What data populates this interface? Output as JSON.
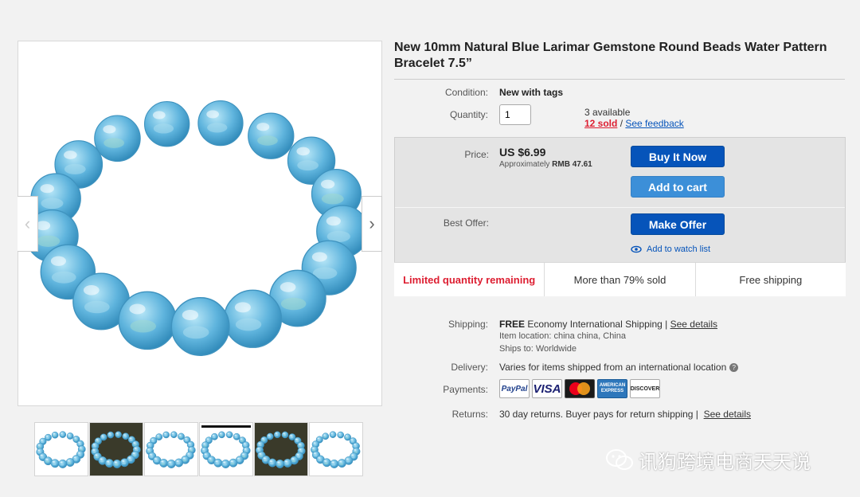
{
  "gallery": {
    "prev_icon": "chevron-left-icon",
    "next_icon": "chevron-right-icon",
    "prev_symbol": "‹",
    "next_symbol": "›",
    "thumbnails": [
      "thumb-1",
      "thumb-2",
      "thumb-3",
      "thumb-4",
      "thumb-5",
      "thumb-6"
    ]
  },
  "item": {
    "title": "New 10mm Natural Blue Larimar Gemstone Round Beads Water Pattern Bracelet 7.5”"
  },
  "details": {
    "condition_label": "Condition:",
    "condition_value": "New with tags",
    "quantity_label": "Quantity:",
    "quantity_value": "1",
    "available": "3 available",
    "sold": "12 sold",
    "sold_sep": " / ",
    "see_feedback": "See feedback"
  },
  "buybox": {
    "price_label": "Price:",
    "price": "US $6.99",
    "approx_prefix": "Approximately ",
    "approx_value": "RMB 47.61",
    "buy_now": "Buy It Now",
    "add_to_cart": "Add to cart",
    "best_offer_label": "Best Offer:",
    "make_offer": "Make Offer",
    "watch": "Add to watch list",
    "limited": "Limited quantity remaining",
    "percent_sold": "More than 79% sold",
    "free_shipping": "Free shipping"
  },
  "shipping": {
    "label": "Shipping:",
    "free": "FREE",
    "method": "Economy International Shipping",
    "sep": " | ",
    "see_details": "See details",
    "location_label": "Item location:",
    "location": "china china, China",
    "ships_to_label": "Ships to:",
    "ships_to": "Worldwide"
  },
  "delivery": {
    "label": "Delivery:",
    "text": "Varies for items shipped from an international location",
    "help_symbol": "?"
  },
  "payments": {
    "label": "Payments:",
    "cards": [
      "PayPal",
      "VISA",
      "MasterCard",
      "AMERICAN EXPRESS",
      "DISCOVER"
    ]
  },
  "returns": {
    "label": "Returns:",
    "text": "30 day returns. Buyer pays for return shipping",
    "sep": " | ",
    "see_details": "See details"
  },
  "watermark": {
    "text": "讯狗跨境电商天天说",
    "icon": "wechat-icon"
  },
  "colors": {
    "primary_button": "#0654ba",
    "cart_button": "#3c8fd8",
    "alert_red": "#dd1e31",
    "bead_blue": "#5fb4dd"
  }
}
